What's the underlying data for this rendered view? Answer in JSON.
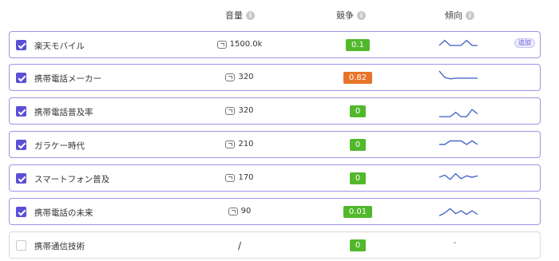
{
  "header": {
    "volume_label": "音量",
    "competition_label": "競争",
    "trend_label": "傾向"
  },
  "colors": {
    "accent": "#5b4fd6",
    "trend_line": "#4a6bc8",
    "badge_green": "#52b82b",
    "badge_orange": "#e8742a"
  },
  "rows": [
    {
      "keyword": "楽天モバイル",
      "volume": "1500.0k",
      "competition": "0.1",
      "competition_color": "green",
      "checked": true,
      "tag": "追加",
      "trend": [
        0.45,
        0.8,
        0.45,
        0.45,
        0.45,
        0.8,
        0.45,
        0.45
      ]
    },
    {
      "keyword": "携帯電話メーカー",
      "volume": "320",
      "competition": "0.82",
      "competition_color": "orange",
      "checked": true,
      "tag": "",
      "trend": [
        0.95,
        0.5,
        0.4,
        0.45,
        0.45,
        0.45,
        0.45,
        0.45
      ]
    },
    {
      "keyword": "携帯電話普及率",
      "volume": "320",
      "competition": "0",
      "competition_color": "green",
      "checked": true,
      "tag": "",
      "trend": [
        0.1,
        0.1,
        0.1,
        0.4,
        0.1,
        0.1,
        0.6,
        0.3
      ]
    },
    {
      "keyword": "ガラケー時代",
      "volume": "210",
      "competition": "0",
      "competition_color": "green",
      "checked": true,
      "tag": "",
      "trend": [
        0.5,
        0.5,
        0.75,
        0.75,
        0.75,
        0.5,
        0.75,
        0.5
      ]
    },
    {
      "keyword": "スマートフォン普及",
      "volume": "170",
      "competition": "0",
      "competition_color": "green",
      "checked": true,
      "tag": "",
      "trend": [
        0.55,
        0.7,
        0.4,
        0.8,
        0.45,
        0.65,
        0.55,
        0.65
      ]
    },
    {
      "keyword": "携帯電話の未来",
      "volume": "90",
      "competition": "0.01",
      "competition_color": "green",
      "checked": true,
      "tag": "",
      "trend": [
        0.2,
        0.4,
        0.7,
        0.35,
        0.55,
        0.3,
        0.55,
        0.3
      ]
    },
    {
      "keyword": "携帯通信技術",
      "volume": "/",
      "competition": "0",
      "competition_color": "green",
      "checked": false,
      "tag": "",
      "trend": [],
      "trend_text": "-"
    }
  ]
}
